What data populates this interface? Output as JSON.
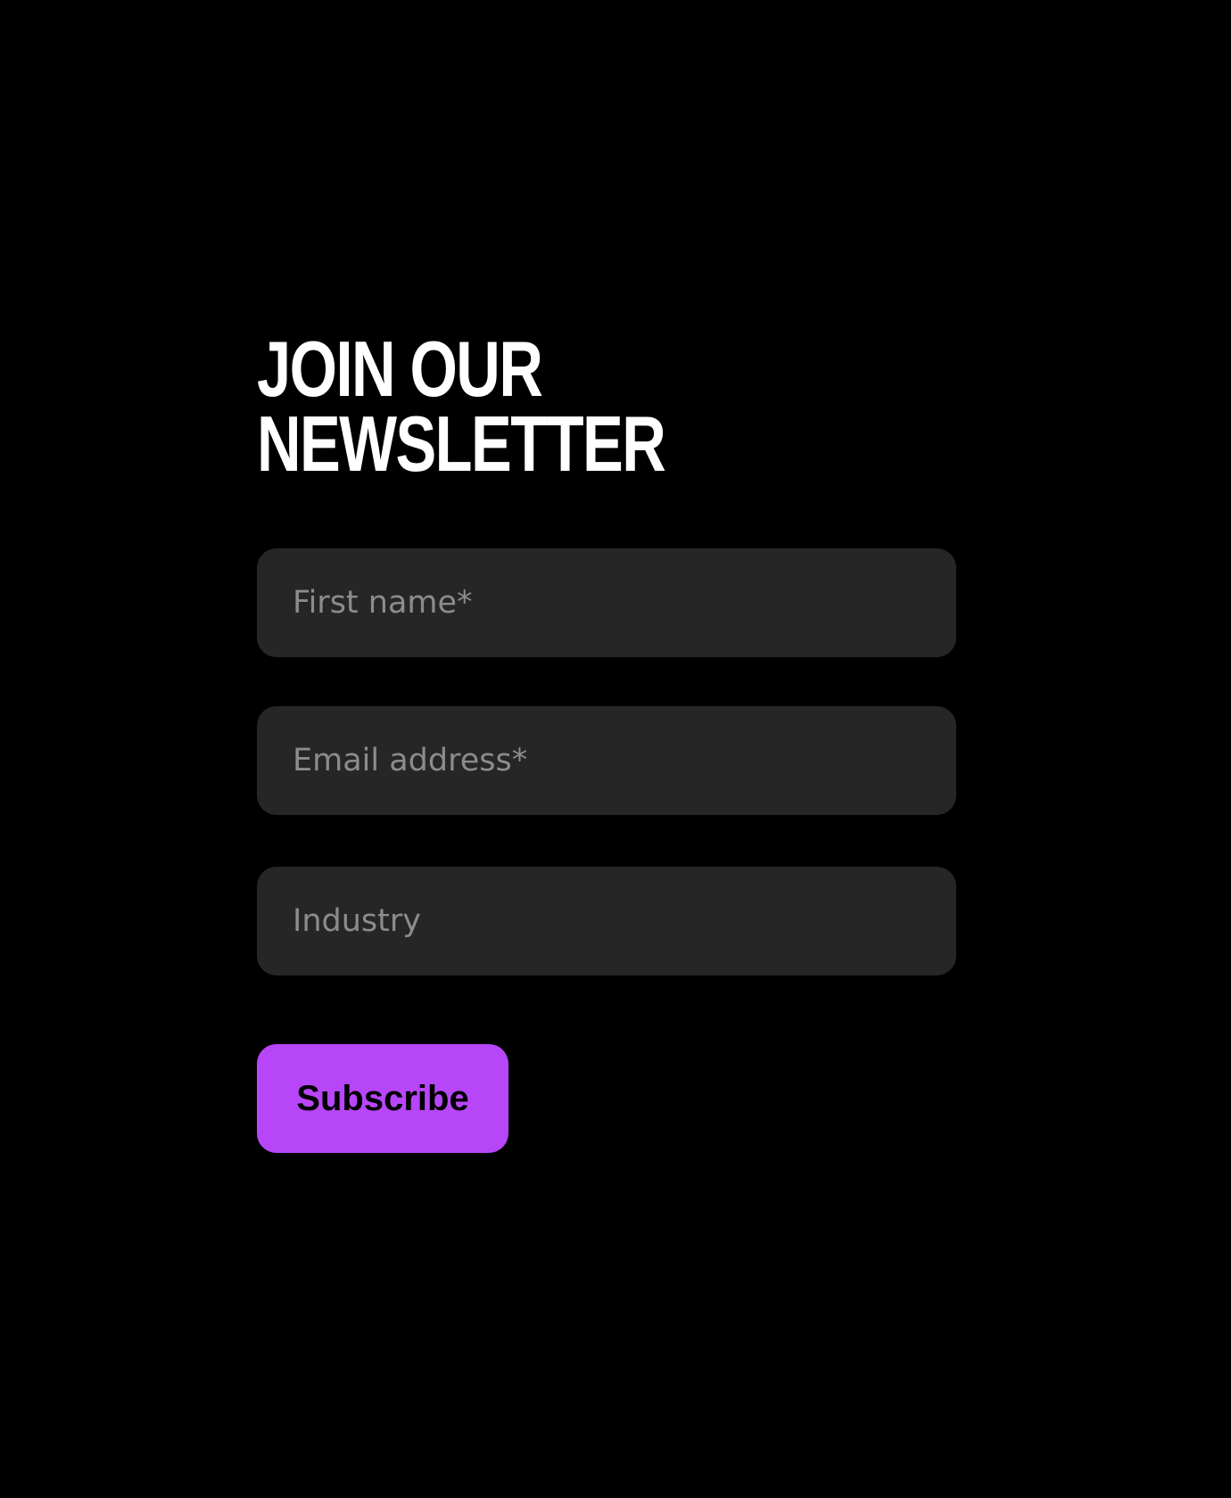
{
  "newsletter": {
    "title_line1": "JOIN OUR",
    "title_line2": "NEWSLETTER",
    "fields": {
      "first_name": {
        "placeholder": "First name*",
        "value": ""
      },
      "email": {
        "placeholder": "Email address*",
        "value": ""
      },
      "industry": {
        "placeholder": "Industry",
        "value": ""
      }
    },
    "subscribe_label": "Subscribe"
  },
  "colors": {
    "background": "#000000",
    "field_background": "#262626",
    "placeholder": "#8c8c8c",
    "title": "#ffffff",
    "accent": "#b846f9"
  }
}
